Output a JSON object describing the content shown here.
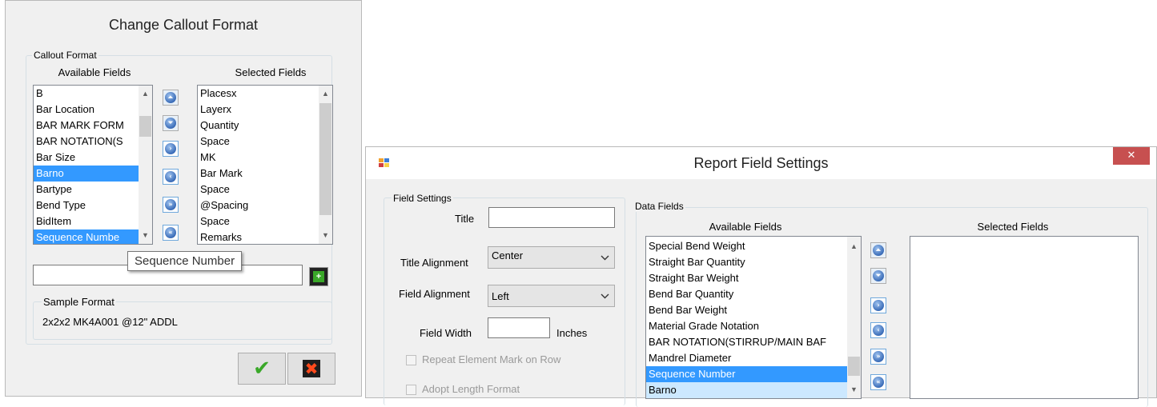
{
  "callout_dialog": {
    "title": "Change Callout Format",
    "group_label": "Callout Format",
    "available_header": "Available Fields",
    "selected_header": "Selected Fields",
    "available_items": [
      "B",
      "Bar Location",
      "BAR MARK FORM",
      "BAR NOTATION(S",
      "Bar Size",
      "Barno",
      "Bartype",
      "Bend Type",
      "BidItem",
      "Sequence Numbe"
    ],
    "available_selected": [
      "Barno",
      "Sequence Numbe"
    ],
    "selected_items": [
      "Placesx",
      "Layerx",
      "Quantity",
      "Space",
      "MK",
      "Bar Mark",
      "Space",
      "@Spacing",
      "Space",
      "Remarks"
    ],
    "tooltip": "Sequence Number",
    "format_value": "",
    "sample_label": "Sample Format",
    "sample_value": "2x2x2 MK4A001 @12\" ADDL",
    "ok_icon": "checkmark-icon",
    "cancel_icon": "red-x-icon"
  },
  "report_dialog": {
    "title": "Report Field Settings",
    "close_glyph": "✕",
    "field_settings_label": "Field Settings",
    "title_label": "Title",
    "title_value": "",
    "title_alignment_label": "Title Alignment",
    "title_alignment_value": "Center",
    "field_alignment_label": "Field Alignment",
    "field_alignment_value": "Left",
    "field_width_label": "Field Width",
    "field_width_value": "",
    "inches_label": "Inches",
    "repeat_label": "Repeat Element Mark on Row",
    "adopt_label": "Adopt Length Format",
    "data_fields_label": "Data Fields",
    "available_header": "Available Fields",
    "selected_header": "Selected Fields",
    "available_items": [
      "Special Bend Weight",
      "Straight Bar Quantity",
      "Straight Bar Weight",
      "Bend Bar Quantity",
      "Bend Bar Weight",
      "Material Grade Notation",
      "BAR NOTATION(STIRRUP/MAIN BAF",
      "Mandrel Diameter",
      "Sequence Number",
      "Barno"
    ],
    "selected_items": []
  },
  "colors": {
    "selection": "#3399ff",
    "close": "#c75050",
    "dialog_bg": "#f0f0f0"
  }
}
